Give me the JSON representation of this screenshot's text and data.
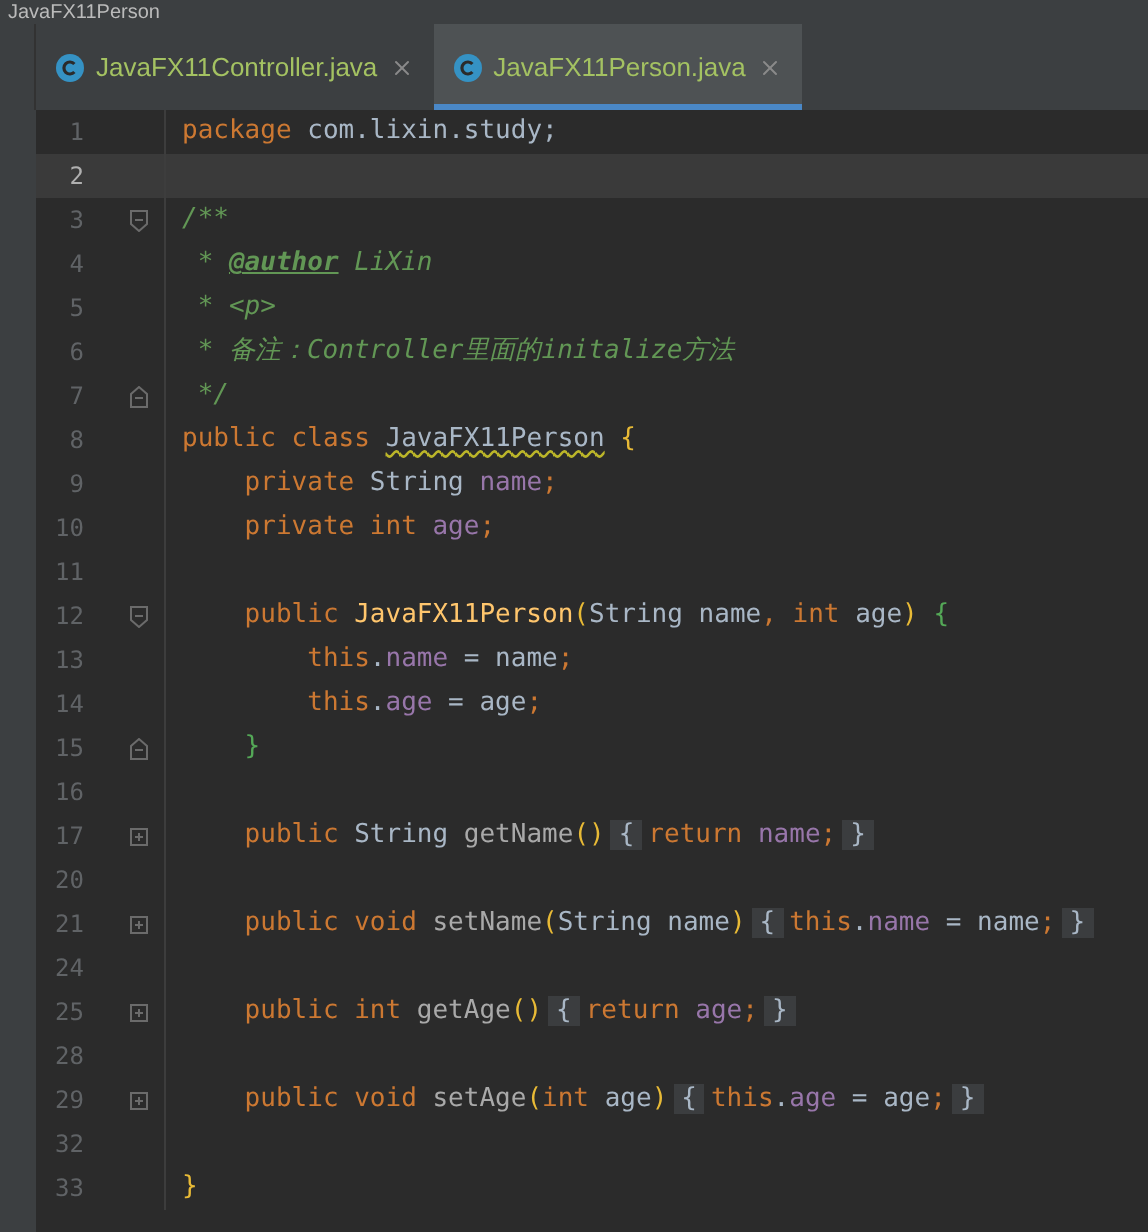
{
  "breadcrumb": "JavaFX11Person",
  "tabs": [
    {
      "label": "JavaFX11Controller.java",
      "selected": false
    },
    {
      "label": "JavaFX11Person.java",
      "selected": true
    }
  ],
  "lines": [
    {
      "n": "1",
      "current": false,
      "tokens": [
        {
          "text": "package",
          "kind": "kw"
        },
        {
          "text": " com.lixin.study;",
          "kind": "txt"
        }
      ]
    },
    {
      "n": "2",
      "current": true
    },
    {
      "n": "3",
      "current": false,
      "fold": {
        "kind": "open"
      },
      "tokens": [
        {
          "text": "/**",
          "kind": "cmt"
        }
      ]
    },
    {
      "n": "4",
      "current": false,
      "tokens": [
        {
          "text": " * ",
          "kind": "cmt"
        },
        {
          "text": "@author",
          "kind": "tag"
        },
        {
          "text": " LiXin",
          "kind": "cmt"
        }
      ]
    },
    {
      "n": "5",
      "current": false,
      "tokens": [
        {
          "text": " * <p>",
          "kind": "cmt"
        }
      ]
    },
    {
      "n": "6",
      "current": false,
      "tokens": [
        {
          "text": " * 备注：Controller里面的initalize方法",
          "kind": "cmt"
        }
      ]
    },
    {
      "n": "7",
      "current": false,
      "fold": {
        "kind": "close"
      },
      "tokens": [
        {
          "text": " */",
          "kind": "cmt"
        }
      ]
    },
    {
      "n": "8",
      "current": false,
      "tokens": [
        {
          "text": "public class ",
          "kind": "kw"
        },
        {
          "text": "JavaFX11Person",
          "kind": "cls"
        },
        {
          "text": " {",
          "kind": "y"
        }
      ]
    },
    {
      "n": "9",
      "current": false,
      "tokens": [
        {
          "text": "    private ",
          "kind": "kw"
        },
        {
          "text": "String ",
          "kind": "txt"
        },
        {
          "text": "name",
          "kind": "fld"
        },
        {
          "text": ";",
          "kind": "kw"
        }
      ]
    },
    {
      "n": "10",
      "current": false,
      "tokens": [
        {
          "text": "    private int ",
          "kind": "kw"
        },
        {
          "text": "age",
          "kind": "fld"
        },
        {
          "text": ";",
          "kind": "kw"
        }
      ]
    },
    {
      "n": "11",
      "current": false
    },
    {
      "n": "12",
      "current": false,
      "fold": {
        "kind": "open"
      },
      "tokens": [
        {
          "text": "    public ",
          "kind": "kw"
        },
        {
          "text": "JavaFX11Person",
          "kind": "fn"
        },
        {
          "text": "(",
          "kind": "y"
        },
        {
          "text": "String name",
          "kind": "txt"
        },
        {
          "text": ", ",
          "kind": "kw"
        },
        {
          "text": "int ",
          "kind": "kw"
        },
        {
          "text": "age",
          "kind": "txt"
        },
        {
          "text": ")",
          "kind": "y"
        },
        {
          "text": " {",
          "kind": "g"
        }
      ]
    },
    {
      "n": "13",
      "current": false,
      "tokens": [
        {
          "text": "        this",
          "kind": "kw"
        },
        {
          "text": ".",
          "kind": "txt"
        },
        {
          "text": "name",
          "kind": "fld"
        },
        {
          "text": " = name",
          "kind": "txt"
        },
        {
          "text": ";",
          "kind": "kw"
        }
      ]
    },
    {
      "n": "14",
      "current": false,
      "tokens": [
        {
          "text": "        this",
          "kind": "kw"
        },
        {
          "text": ".",
          "kind": "txt"
        },
        {
          "text": "age",
          "kind": "fld"
        },
        {
          "text": " = age",
          "kind": "txt"
        },
        {
          "text": ";",
          "kind": "kw"
        }
      ]
    },
    {
      "n": "15",
      "current": false,
      "fold": {
        "kind": "close"
      },
      "tokens": [
        {
          "text": "    }",
          "kind": "g"
        }
      ]
    },
    {
      "n": "16",
      "current": false
    },
    {
      "n": "17",
      "current": false,
      "fold": {
        "kind": "plus"
      },
      "tokens": [
        {
          "text": "    public ",
          "kind": "kw"
        },
        {
          "text": "String ",
          "kind": "txt"
        },
        {
          "text": "getName",
          "kind": "dim"
        },
        {
          "text": "()",
          "kind": "y"
        },
        {
          "text": "{",
          "kind": "chip"
        },
        {
          "text": "return ",
          "kind": "kw"
        },
        {
          "text": "name",
          "kind": "fld"
        },
        {
          "text": ";",
          "kind": "kw"
        },
        {
          "text": "}",
          "kind": "chip"
        }
      ]
    },
    {
      "n": "20",
      "current": false
    },
    {
      "n": "21",
      "current": false,
      "fold": {
        "kind": "plus"
      },
      "tokens": [
        {
          "text": "    public void ",
          "kind": "kw"
        },
        {
          "text": "setName",
          "kind": "dim"
        },
        {
          "text": "(",
          "kind": "y"
        },
        {
          "text": "String name",
          "kind": "txt"
        },
        {
          "text": ")",
          "kind": "y"
        },
        {
          "text": "{",
          "kind": "chip"
        },
        {
          "text": "this",
          "kind": "kw"
        },
        {
          "text": ".",
          "kind": "txt"
        },
        {
          "text": "name",
          "kind": "fld"
        },
        {
          "text": " = name",
          "kind": "txt"
        },
        {
          "text": ";",
          "kind": "kw"
        },
        {
          "text": "}",
          "kind": "chip"
        }
      ]
    },
    {
      "n": "24",
      "current": false
    },
    {
      "n": "25",
      "current": false,
      "fold": {
        "kind": "plus"
      },
      "tokens": [
        {
          "text": "    public int ",
          "kind": "kw"
        },
        {
          "text": "getAge",
          "kind": "dim"
        },
        {
          "text": "()",
          "kind": "y"
        },
        {
          "text": "{",
          "kind": "chip"
        },
        {
          "text": "return ",
          "kind": "kw"
        },
        {
          "text": "age",
          "kind": "fld"
        },
        {
          "text": ";",
          "kind": "kw"
        },
        {
          "text": "}",
          "kind": "chip"
        }
      ]
    },
    {
      "n": "28",
      "current": false
    },
    {
      "n": "29",
      "current": false,
      "fold": {
        "kind": "plus"
      },
      "tokens": [
        {
          "text": "    public void ",
          "kind": "kw"
        },
        {
          "text": "setAge",
          "kind": "dim"
        },
        {
          "text": "(",
          "kind": "y"
        },
        {
          "text": "int ",
          "kind": "kw"
        },
        {
          "text": "age",
          "kind": "txt"
        },
        {
          "text": ")",
          "kind": "y"
        },
        {
          "text": "{",
          "kind": "chip"
        },
        {
          "text": "this",
          "kind": "kw"
        },
        {
          "text": ".",
          "kind": "txt"
        },
        {
          "text": "age",
          "kind": "fld"
        },
        {
          "text": " = age",
          "kind": "txt"
        },
        {
          "text": ";",
          "kind": "kw"
        },
        {
          "text": "}",
          "kind": "chip"
        }
      ]
    },
    {
      "n": "32",
      "current": false
    },
    {
      "n": "33",
      "current": false,
      "tokens": [
        {
          "text": "}",
          "kind": "y"
        }
      ]
    }
  ]
}
